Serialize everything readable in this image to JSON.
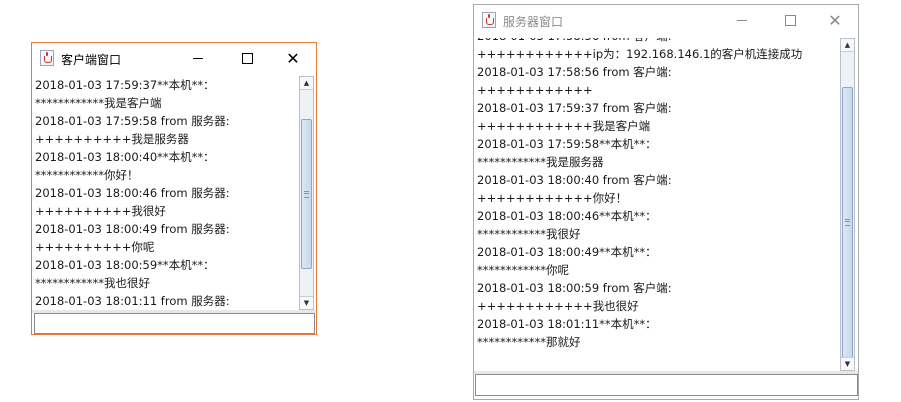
{
  "client_window": {
    "title": "客户端窗口",
    "input_value": "",
    "messages": [
      "2018-01-03 17:59:37**本机**：",
      "************我是客户端",
      "2018-01-03 17:59:58 from 服务器:",
      "++++++++++我是服务器",
      "2018-01-03 18:00:40**本机**：",
      "************你好！",
      "2018-01-03 18:00:46 from 服务器:",
      "++++++++++我很好",
      "2018-01-03 18:00:49 from 服务器:",
      "++++++++++你呢",
      "2018-01-03 18:00:59**本机**：",
      "************我也很好",
      "2018-01-03 18:01:11 from 服务器:"
    ]
  },
  "server_window": {
    "title": "服务器窗口",
    "input_value": "",
    "messages": [
      "2018-01-03 17:58:56 from 客户端:",
      "++++++++++++ip为：192.168.146.1的客户机连接成功",
      "2018-01-03 17:58:56 from 客户端:",
      "++++++++++++",
      "2018-01-03 17:59:37 from 客户端:",
      "++++++++++++我是客户端",
      "2018-01-03 17:59:58**本机**：",
      "************我是服务器",
      "2018-01-03 18:00:40 from 客户端:",
      "++++++++++++你好！",
      "2018-01-03 18:00:46**本机**：",
      "************我很好",
      "2018-01-03 18:00:49**本机**：",
      "************你呢",
      "2018-01-03 18:00:59 from 客户端:",
      "++++++++++++我也很好",
      "2018-01-03 18:01:11**本机**：",
      "************那就好"
    ]
  },
  "window_buttons": {
    "minimize": "",
    "maximize": "",
    "close": "✕"
  },
  "icons": {
    "app": "java-cup-icon",
    "minimize": "minimize-icon",
    "maximize": "maximize-icon",
    "close": "close-icon"
  },
  "colors": {
    "client_border": "#e8773a",
    "server_border": "#aaaaaa",
    "scroll_thumb": "#c8d8ec"
  }
}
